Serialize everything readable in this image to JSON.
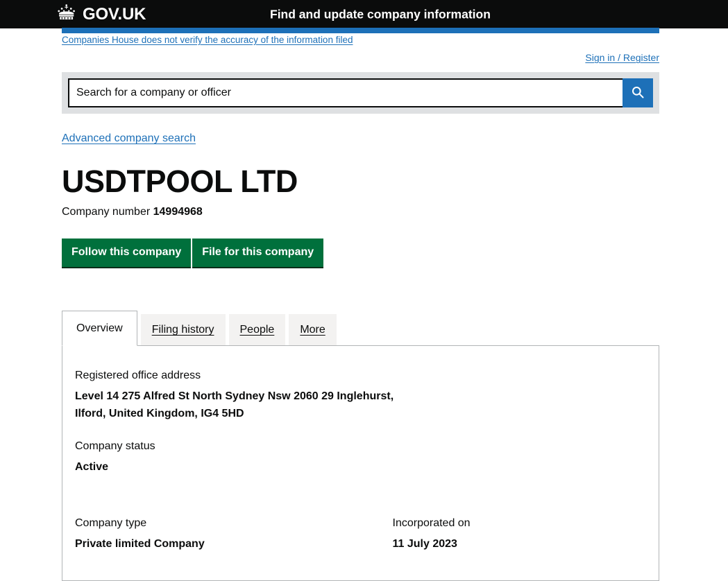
{
  "header": {
    "brand_text": "GOV.UK",
    "crown_icon": "crown-icon",
    "service_name": "Find and update company information"
  },
  "notice": {
    "text": "Companies House does not verify the accuracy of the information filed"
  },
  "account": {
    "signin_label": "Sign in / Register"
  },
  "search": {
    "placeholder": "Search for a company or officer",
    "value": "",
    "button_icon": "search-icon",
    "button_label": "Search"
  },
  "links": {
    "advanced_search": "Advanced company search"
  },
  "company": {
    "name": "USDTPOOL LTD",
    "number_label": "Company number",
    "number": "14994968"
  },
  "actions": {
    "follow_label": "Follow this company",
    "file_label": "File for this company"
  },
  "tabs": [
    {
      "label": "Overview",
      "active": true
    },
    {
      "label": "Filing history",
      "active": false
    },
    {
      "label": "People",
      "active": false
    },
    {
      "label": "More",
      "active": false
    }
  ],
  "overview": {
    "address_label": "Registered office address",
    "address_line_1": "Level 14 275 Alfred St North Sydney Nsw 2060 29 Inglehurst,",
    "address_line_2": "Ilford, United Kingdom, IG4 5HD",
    "status_label": "Company status",
    "status_value": "Active",
    "type_label": "Company type",
    "type_value": "Private limited Company",
    "incorporated_label": "Incorporated on",
    "incorporated_value": "11 July 2023"
  },
  "colors": {
    "brand_black": "#0b0c0c",
    "link_blue": "#1d70b8",
    "button_green": "#00703c",
    "search_band_grey": "#dee0e2",
    "tab_grey": "#f3f2f1",
    "border_grey": "#b1b4b6"
  }
}
